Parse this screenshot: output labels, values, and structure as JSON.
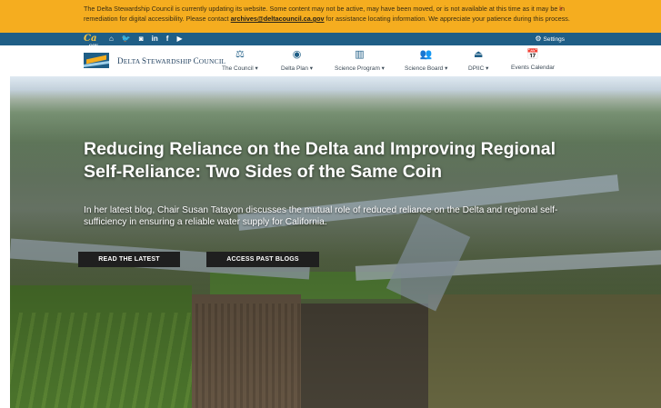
{
  "alert": {
    "text": "The Delta Stewardship Council is currently updating its website. Some content may not be active, may have been moved, or is not available at this time as it may be in remediation for digital accessibility. Please contact ",
    "email": "archives@deltacouncil.ca.gov",
    "text_after": " for assistance locating information. We appreciate your patience during this process.",
    "close": "×"
  },
  "utility": {
    "ca_logo": "Ca",
    "ca_logo_small": "GOV",
    "social": [
      {
        "icon": "home-icon",
        "glyph": "⌂"
      },
      {
        "icon": "twitter-icon",
        "glyph": "🐦"
      },
      {
        "icon": "instagram-icon",
        "glyph": "◙"
      },
      {
        "icon": "linkedin-icon",
        "glyph": "in"
      },
      {
        "icon": "facebook-icon",
        "glyph": "f"
      },
      {
        "icon": "youtube-icon",
        "glyph": "▶"
      }
    ],
    "settings_label": "Settings"
  },
  "header": {
    "brand_name_1": "D",
    "brand_name_2": "ELTA ",
    "brand_name_3": "S",
    "brand_name_4": "TEWARDSHIP ",
    "brand_name_5": "C",
    "brand_name_6": "OUNCIL",
    "nav": [
      {
        "label": "The Council ▾",
        "icon": "scales-icon",
        "glyph": "⚖"
      },
      {
        "label": "Delta Plan ▾",
        "icon": "delta-plan-icon",
        "glyph": "◉"
      },
      {
        "label": "Science Program ▾",
        "icon": "science-chart-icon",
        "glyph": "▥"
      },
      {
        "label": "Science Board ▾",
        "icon": "people-group-icon",
        "glyph": "👥"
      },
      {
        "label": "DPIIC ▾",
        "icon": "building-icon",
        "glyph": "⏏"
      },
      {
        "label": "Events Calendar",
        "icon": "calendar-icon",
        "glyph": "📅"
      }
    ]
  },
  "hero": {
    "title": "Reducing Reliance on the Delta and Improving Regional Self-Reliance: Two Sides of the Same Coin",
    "subtitle": "In her latest blog, Chair Susan Tatayon discusses the mutual role of reduced reliance on the Delta and regional self-sufficiency in ensuring a reliable water supply for California.",
    "button_read": "READ THE LATEST",
    "button_past": "ACCESS PAST BLOGS"
  }
}
